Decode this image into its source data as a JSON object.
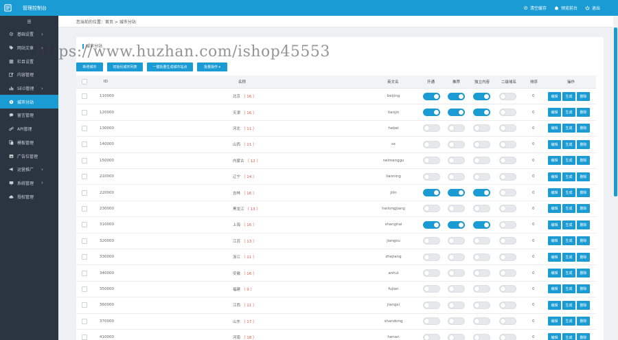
{
  "app_title": "管理控制台",
  "top_links": [
    {
      "label": "清空缓存",
      "icon": "gear-icon"
    },
    {
      "label": "预览前台",
      "icon": "home-icon"
    },
    {
      "label": "退出",
      "icon": "power-icon"
    }
  ],
  "sidebar": {
    "toggle_icon": "menu-icon",
    "items": [
      {
        "label": "基础设置",
        "icon": "gear-icon",
        "has_arrow": true
      },
      {
        "label": "网站文章",
        "icon": "tag-icon",
        "has_arrow": true
      },
      {
        "label": "栏目设置",
        "icon": "list-icon",
        "has_arrow": false
      },
      {
        "label": "内容管理",
        "icon": "edit-icon",
        "has_arrow": false
      },
      {
        "label": "SEO管理",
        "icon": "bar-chart-icon",
        "has_arrow": true
      },
      {
        "label": "城市分站",
        "icon": "globe-icon",
        "has_arrow": false,
        "active": true
      },
      {
        "label": "留言管理",
        "icon": "comment-icon",
        "has_arrow": false
      },
      {
        "label": "API管理",
        "icon": "link-icon",
        "has_arrow": false
      },
      {
        "label": "模板管理",
        "icon": "copy-icon",
        "has_arrow": false
      },
      {
        "label": "广告位管理",
        "icon": "image-icon",
        "has_arrow": false
      },
      {
        "label": "运营推广",
        "icon": "bullhorn-icon",
        "has_arrow": true
      },
      {
        "label": "系统管理",
        "icon": "monitor-icon",
        "has_arrow": true
      },
      {
        "label": "授权管理",
        "icon": "cloud-icon",
        "has_arrow": false
      }
    ]
  },
  "breadcrumb": "您当前的位置：首页 > 城市分站",
  "panel_title": "城市分站",
  "watermark": "https://www.huzhan.com/ishop45553",
  "toolbar": [
    "新增城市",
    "初始化城市列表",
    "一键批量生成城市站点",
    "批量操作 ▾"
  ],
  "columns": {
    "id": "ID",
    "name": "名称",
    "en": "英文名",
    "c1": "开通",
    "c2": "推荐",
    "c3": "独立内容",
    "c4": "二级域名",
    "sort": "排序",
    "ops": "操作"
  },
  "action_labels": [
    "编辑",
    "生成",
    "删除"
  ],
  "rows": [
    {
      "id": "110000",
      "name": "北京",
      "count": "（ 16 ）",
      "en": "beijing",
      "t": [
        true,
        true,
        true,
        false
      ],
      "sort": "0"
    },
    {
      "id": "120000",
      "name": "天津",
      "count": "（ 16 ）",
      "en": "tianjin",
      "t": [
        true,
        true,
        true,
        false
      ],
      "sort": "0"
    },
    {
      "id": "130000",
      "name": "河北",
      "count": "（ 11 ）",
      "en": "hebei",
      "t": [
        false,
        false,
        false,
        false
      ],
      "sort": "0"
    },
    {
      "id": "140000",
      "name": "山西",
      "count": "（ 11 ）",
      "en": "sx",
      "t": [
        false,
        false,
        false,
        false
      ],
      "sort": "0"
    },
    {
      "id": "150000",
      "name": "内蒙古",
      "count": "（ 12 ）",
      "en": "neimenggu",
      "t": [
        false,
        false,
        false,
        false
      ],
      "sort": "0"
    },
    {
      "id": "210000",
      "name": "辽宁",
      "count": "（ 14 ）",
      "en": "liaoning",
      "t": [
        false,
        false,
        false,
        false
      ],
      "sort": "0"
    },
    {
      "id": "220000",
      "name": "吉林",
      "count": "（ 16 ）",
      "en": "jilin",
      "t": [
        true,
        true,
        true,
        false
      ],
      "sort": "0"
    },
    {
      "id": "230000",
      "name": "黑龙江",
      "count": "（ 13 ）",
      "en": "heilongjiang",
      "t": [
        false,
        false,
        false,
        false
      ],
      "sort": "0"
    },
    {
      "id": "310000",
      "name": "上海",
      "count": "（ 16 ）",
      "en": "shanghai",
      "t": [
        true,
        true,
        true,
        false
      ],
      "sort": "0"
    },
    {
      "id": "320000",
      "name": "江苏",
      "count": "（ 13 ）",
      "en": "jiangsu",
      "t": [
        false,
        false,
        false,
        false
      ],
      "sort": "0"
    },
    {
      "id": "330000",
      "name": "浙江",
      "count": "（ 11 ）",
      "en": "zhejiang",
      "t": [
        false,
        false,
        false,
        false
      ],
      "sort": "0"
    },
    {
      "id": "340000",
      "name": "安徽",
      "count": "（ 16 ）",
      "en": "anhui",
      "t": [
        false,
        false,
        false,
        false
      ],
      "sort": "0"
    },
    {
      "id": "350000",
      "name": "福建",
      "count": "（ 9 ）",
      "en": "fujian",
      "t": [
        false,
        false,
        false,
        false
      ],
      "sort": "0"
    },
    {
      "id": "360000",
      "name": "江西",
      "count": "（ 11 ）",
      "en": "jiangxi",
      "t": [
        false,
        false,
        false,
        false
      ],
      "sort": "0"
    },
    {
      "id": "370000",
      "name": "山东",
      "count": "（ 17 ）",
      "en": "shandong",
      "t": [
        false,
        false,
        false,
        false
      ],
      "sort": "0"
    },
    {
      "id": "410000",
      "name": "河南",
      "count": "（ 18 ）",
      "en": "henan",
      "t": [
        false,
        false,
        false,
        false
      ],
      "sort": "0"
    }
  ],
  "colors": {
    "accent": "#1b9bd4",
    "sidebar": "#2b3441",
    "count": "#e2533e"
  }
}
